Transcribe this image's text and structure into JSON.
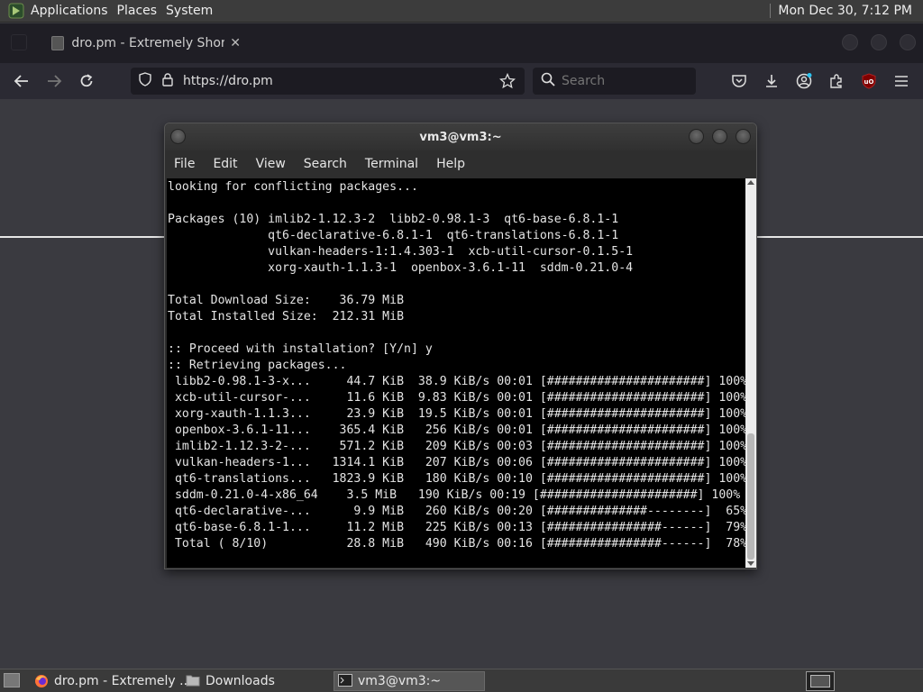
{
  "top_panel": {
    "menus": [
      "Applications",
      "Places",
      "System"
    ],
    "clock": "Mon Dec 30,  7:12 PM"
  },
  "browser": {
    "tab": {
      "title": "dro.pm - Extremely Short U"
    },
    "url": "https://dro.pm",
    "search_placeholder": "Search"
  },
  "terminal": {
    "title": "vm3@vm3:~",
    "menu": [
      "File",
      "Edit",
      "View",
      "Search",
      "Terminal",
      "Help"
    ],
    "lines": [
      "looking for conflicting packages...",
      "",
      "Packages (10) imlib2-1.12.3-2  libb2-0.98.1-3  qt6-base-6.8.1-1",
      "              qt6-declarative-6.8.1-1  qt6-translations-6.8.1-1",
      "              vulkan-headers-1:1.4.303-1  xcb-util-cursor-0.1.5-1",
      "              xorg-xauth-1.1.3-1  openbox-3.6.1-11  sddm-0.21.0-4",
      "",
      "Total Download Size:    36.79 MiB",
      "Total Installed Size:  212.31 MiB",
      "",
      ":: Proceed with installation? [Y/n] y",
      ":: Retrieving packages...",
      " libb2-0.98.1-3-x...     44.7 KiB  38.9 KiB/s 00:01 [######################] 100%",
      " xcb-util-cursor-...     11.6 KiB  9.83 KiB/s 00:01 [######################] 100%",
      " xorg-xauth-1.1.3...     23.9 KiB  19.5 KiB/s 00:01 [######################] 100%",
      " openbox-3.6.1-11...    365.4 KiB   256 KiB/s 00:01 [######################] 100%",
      " imlib2-1.12.3-2-...    571.2 KiB   209 KiB/s 00:03 [######################] 100%",
      " vulkan-headers-1...   1314.1 KiB   207 KiB/s 00:06 [######################] 100%",
      " qt6-translations...   1823.9 KiB   180 KiB/s 00:10 [######################] 100%",
      " sddm-0.21.0-4-x86_64    3.5 MiB   190 KiB/s 00:19 [######################] 100%",
      " qt6-declarative-...      9.9 MiB   260 KiB/s 00:20 [##############--------]  65%",
      " qt6-base-6.8.1-1...     11.2 MiB   225 KiB/s 00:13 [################------]  79%",
      " Total ( 8/10)           28.8 MiB   490 KiB/s 00:16 [################------]  78%"
    ]
  },
  "taskbar": {
    "items": [
      "dro.pm - Extremely ...",
      "Downloads",
      "vm3@vm3:~"
    ]
  },
  "colors": {
    "firefox_orange": "#ff7139",
    "ublock_red": "#800000"
  }
}
